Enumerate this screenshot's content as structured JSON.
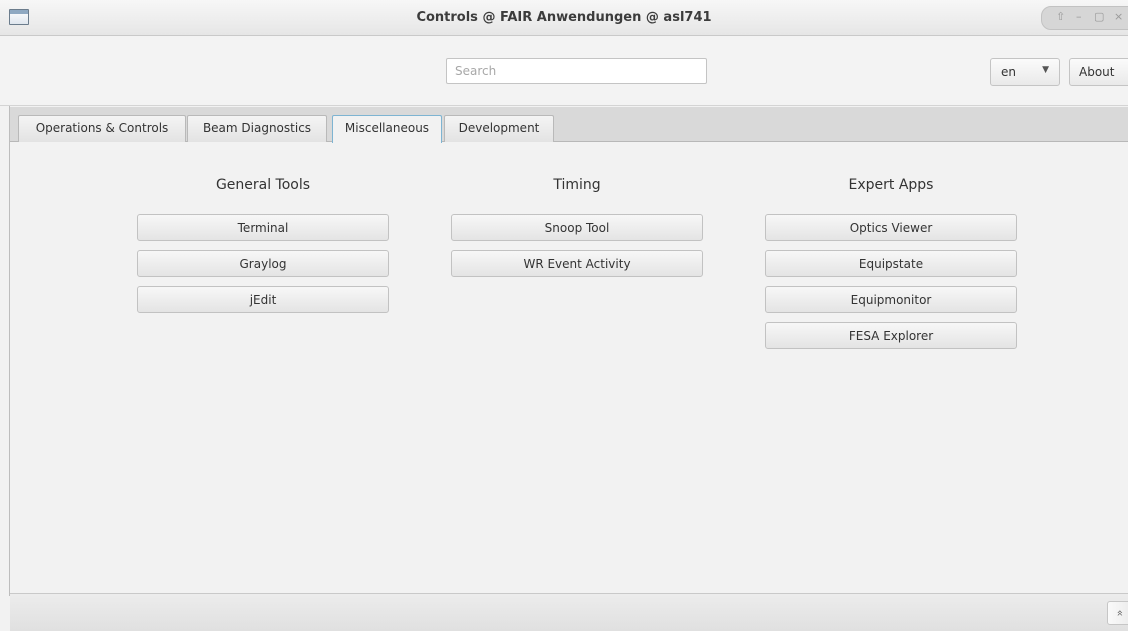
{
  "window": {
    "title": "Controls @ FAIR Anwendungen @ asl741",
    "controls": [
      "⇧",
      "–",
      "▢",
      "×"
    ]
  },
  "toolbar": {
    "search_placeholder": "Search",
    "language": "en",
    "about_label": "About"
  },
  "tabs": [
    {
      "label": "Operations & Controls",
      "active": false
    },
    {
      "label": "Beam Diagnostics",
      "active": false
    },
    {
      "label": "Miscellaneous",
      "active": true
    },
    {
      "label": "Development",
      "active": false
    }
  ],
  "columns": [
    {
      "heading": "General Tools",
      "buttons": [
        "Terminal",
        "Graylog",
        "jEdit"
      ]
    },
    {
      "heading": "Timing",
      "buttons": [
        "Snoop Tool",
        "WR Event Activity"
      ]
    },
    {
      "heading": "Expert Apps",
      "buttons": [
        "Optics Viewer",
        "Equipstate",
        "Equipmonitor",
        "FESA Explorer"
      ]
    }
  ],
  "statusbar": {
    "expand_icon": "double-chevron-up"
  },
  "colors": {
    "active_tab_border": "#7eb4d2"
  }
}
